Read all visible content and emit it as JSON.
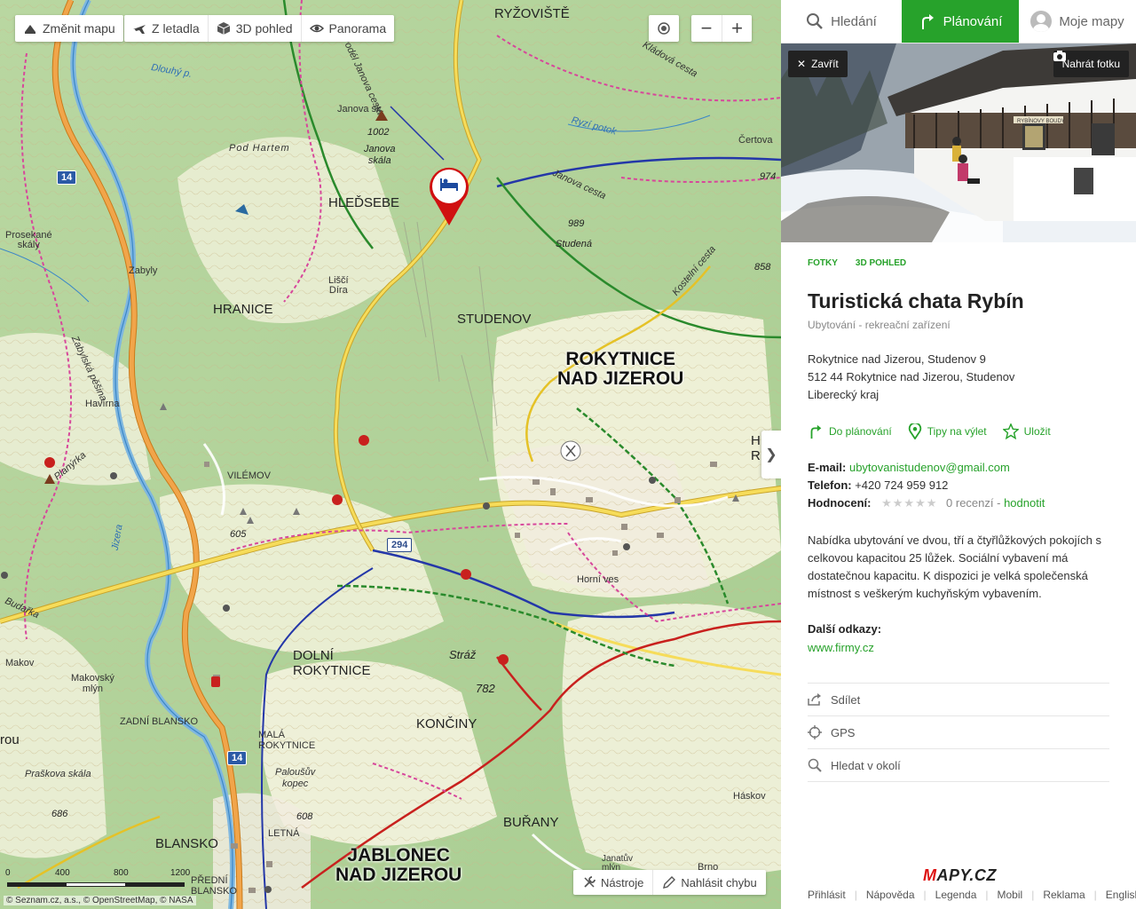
{
  "map": {
    "controls": {
      "change_map": "Změnit mapu",
      "aerial": "Z letadla",
      "view3d": "3D pohled",
      "panorama": "Panorama",
      "zoom_out": "−",
      "zoom_in": "+"
    },
    "labels": {
      "ryzoviste": "RYŽOVIŠTĚ",
      "hledsebe": "HLEĎSEBE",
      "hranice": "HRANICE",
      "studenov": "STUDENOV",
      "rokytnice": "ROKYTNICE\nNAD JIZEROU",
      "havirna": "Havírna",
      "vilemov": "VILÉMOV",
      "dolni_rokytnice": "DOLNÍ\nROKYTNICE",
      "konciny": "KONČINY",
      "zadni_blansko": "ZADNÍ BLANSKO",
      "mala_rokytnice": "MALÁ\nROKYTNICE",
      "blansko": "BLANSKO",
      "burany": "BUŘANY",
      "jablonec": "JABLONEC\nNAD JIZEROU",
      "letna": "LETNÁ",
      "predni_blansko": "PŘEDNÍ\nBLANSKO",
      "horni_ves": "Horní ves",
      "zabyly": "Zabyly",
      "makov": "Makov",
      "makovsky_mlyn": "Makovský\nmlýn",
      "budarka": "Budařka",
      "praskova_skala": "Praškova skála",
      "palouslv_kopec": "Paloušův\nkopec",
      "straz": "Stráž",
      "janova_skala": "Janova\nskála",
      "janova_sk": "Janova sk.",
      "pod_hartem": "Pod Hartem",
      "studena": "Studená",
      "lisci_dira": "Liščí\nDíra",
      "prosekane_skaly": "Prosekané\nskály",
      "certova": "Čertova",
      "haskov": "Háskov",
      "janatuv_mlyn": "Janatův\nmlýn",
      "brno": "Brno",
      "rou": "rou",
      "h_edge": "H\nR",
      "dlouhy_p": "Dlouhý p.",
      "ryzi_potok": "Ryzí potok",
      "jizera": "Jizera",
      "planyrka": "Planýrka",
      "kladova_cesta": "Kládová cesta",
      "janova_cesta": "Janova cesta",
      "kostelni_cesta": "Kostelní cesta",
      "podel_janova": "Podél Janova cesta",
      "zabylska": "Zabylská pěšina"
    },
    "elevations": {
      "e1002": "1002",
      "e989": "989",
      "e974": "974",
      "e858": "858",
      "e782": "782",
      "e605": "605",
      "e686": "686",
      "e608": "608"
    },
    "road_shields": {
      "r14a": "14",
      "r14b": "14",
      "r294": "294"
    },
    "scale": {
      "ticks": [
        "0",
        "400",
        "800",
        "1200"
      ],
      "unit": "m"
    },
    "attribution": "© Seznam.cz, a.s., © OpenStreetMap, © NASA",
    "tools": {
      "tools_label": "Nástroje",
      "report_label": "Nahlásit chybu"
    }
  },
  "panel": {
    "tabs": {
      "search": "Hledání",
      "plan": "Plánování",
      "mymaps": "Moje mapy"
    },
    "photo": {
      "close": "Zavřít",
      "upload": "Nahrát fotku",
      "sign": "RYBÍNOVY BOUDY"
    },
    "photo_tabs": {
      "photos": "FOTKY",
      "view3d": "3D POHLED"
    },
    "poi": {
      "title": "Turistická chata Rybín",
      "category": "Ubytování - rekreační zařízení",
      "address_line1": "Rokytnice nad Jizerou, Studenov 9",
      "address_line2": "512 44  Rokytnice nad Jizerou, Studenov",
      "address_line3": "Liberecký kraj",
      "actions": {
        "plan": "Do plánování",
        "trip": "Tipy na výlet",
        "save": "Uložit"
      },
      "email_label": "E-mail:",
      "email": "ubytovanistudenov@gmail.com",
      "phone_label": "Telefon:",
      "phone": "+420 724 959 912",
      "rating_label": "Hodnocení:",
      "stars": "★★★★★",
      "reviews": "0 recenzí",
      "rate_sep": " - ",
      "rate": "hodnotit",
      "description": "Nabídka ubytování ve dvou, tří a čtyřlůžkových pokojích s celkovou kapacitou 25 lůžek. Sociální vybavení má dostatečnou kapacitu. K dispozici je velká společenská místnost s veškerým kuchyňským vybavením.",
      "links_heading": "Další odkazy:",
      "link": "www.firmy.cz"
    },
    "tools": {
      "share": "Sdílet",
      "gps": "GPS",
      "nearby": "Hledat v okolí"
    },
    "logo": {
      "first": "M",
      "rest": "APY.CZ"
    },
    "footer": [
      "Přihlásit",
      "Nápověda",
      "Legenda",
      "Mobil",
      "Reklama",
      "English"
    ]
  },
  "colors": {
    "accent_green": "#27a22b",
    "road_yellow": "#f2d04a",
    "road_orange": "#f1a54a",
    "trail_red": "#c8211e",
    "trail_blue": "#2437a8",
    "trail_green": "#2a8a2c",
    "cycle_pink": "#d7479b",
    "river": "#3a86c8"
  },
  "icons": [
    "search-icon",
    "plan-arrow-icon",
    "avatar-icon",
    "close-icon",
    "camera-icon",
    "target-icon",
    "star-icon",
    "share-icon",
    "gps-icon",
    "search-nearby-icon",
    "hotel-icon",
    "map-change-icon",
    "plane-icon",
    "cube-icon",
    "eye-icon",
    "wrench-icon",
    "pencil-icon"
  ]
}
